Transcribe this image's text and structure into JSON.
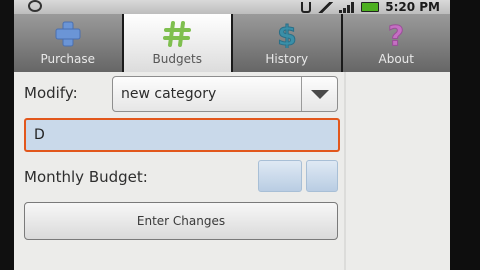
{
  "status_bar": {
    "time": "5:20 PM",
    "icons": [
      "notification-icon",
      "usb-icon",
      "wifi-icon",
      "signal-icon",
      "battery-icon"
    ],
    "battery_color": "#4caf1f"
  },
  "tabs": [
    {
      "label": "Purchase",
      "icon": "plus-icon",
      "active": false
    },
    {
      "label": "Budgets",
      "icon": "hash-icon",
      "active": true
    },
    {
      "label": "History",
      "icon": "dollar-icon",
      "active": false
    },
    {
      "label": "About",
      "icon": "question-icon",
      "active": false
    }
  ],
  "form": {
    "modify_label": "Modify:",
    "modify_value": "new category",
    "name_value": "D",
    "monthly_budget_label": "Monthly Budget:",
    "enter_button_label": "Enter Changes"
  },
  "colors": {
    "focus_border": "#e2571c",
    "input_fill": "#c9d9ea",
    "tab_active": "#ffffff",
    "tab_inactive": "#8a8a8a"
  }
}
